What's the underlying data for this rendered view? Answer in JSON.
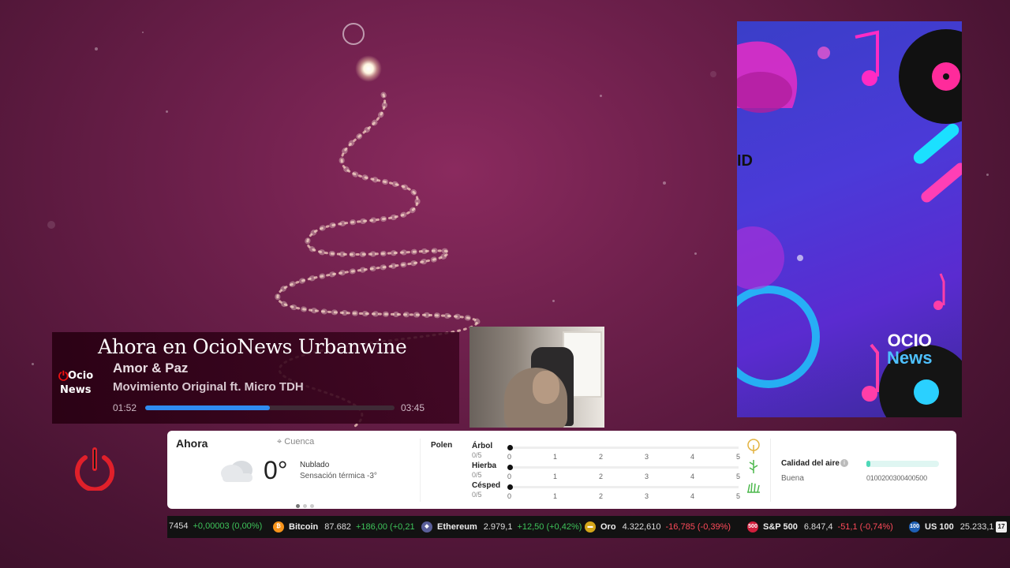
{
  "now_playing": {
    "header": "Ahora en OcioNews Urbanwine",
    "song": "Amor & Paz",
    "artist": "Movimiento Original ft. Micro TDH",
    "elapsed": "01:52",
    "duration": "03:45",
    "progress": 0.5,
    "logo_text_1": "Ocio",
    "logo_text_2": "News"
  },
  "promo": {
    "logo_line1": "OCIO",
    "logo_line2": "News",
    "side_text": "ID"
  },
  "weather": {
    "title": "Ahora",
    "location": "Cuenca",
    "temperature": "0°",
    "condition": "Nublado",
    "feels_like": "Sensación térmica -3°",
    "pollen_label": "Polen",
    "pollen": [
      {
        "name": "Árbol",
        "value": "0/5",
        "level": 0
      },
      {
        "name": "Hierba",
        "value": "0/5",
        "level": 0
      },
      {
        "name": "Césped",
        "value": "0/5",
        "level": 0
      }
    ],
    "pollen_scale": [
      "0",
      "1",
      "2",
      "3",
      "4",
      "5"
    ],
    "air_quality_label": "Calidad del aire",
    "air_quality_value": "Buena",
    "air_quality_scale": "0100200300400500",
    "air_quality_level": 0.05
  },
  "ticker": {
    "items": [
      {
        "name": "",
        "price": "7454",
        "change": "+0,00003 (0,00%)",
        "dir": "pos",
        "icon": "",
        "color": ""
      },
      {
        "name": "Bitcoin",
        "price": "87.682",
        "change": "+186,00 (+0,21",
        "dir": "pos",
        "icon": "₿",
        "color": "#f7931a"
      },
      {
        "name": "Ethereum",
        "price": "2.979,1",
        "change": "+12,50 (+0,42%)",
        "dir": "pos",
        "icon": "◆",
        "color": "#5a5f9a"
      },
      {
        "name": "Oro",
        "price": "4.322,610",
        "change": "-16,785 (-0,39%)",
        "dir": "neg",
        "icon": "▬",
        "color": "#d4a619"
      },
      {
        "name": "S&P 500",
        "price": "6.847,4",
        "change": "-51,1 (-0,74%)",
        "dir": "neg",
        "icon": "500",
        "color": "#d11e3c"
      },
      {
        "name": "US 100",
        "price": "25.233,1",
        "change": "",
        "dir": "pos",
        "icon": "100",
        "color": "#1e5fb4"
      }
    ],
    "tail_logo": "17"
  },
  "colors": {
    "accent_progress": "#2f8cf0",
    "power_red": "#e0202a",
    "positive": "#3ec35a",
    "negative": "#ff4a5a"
  }
}
